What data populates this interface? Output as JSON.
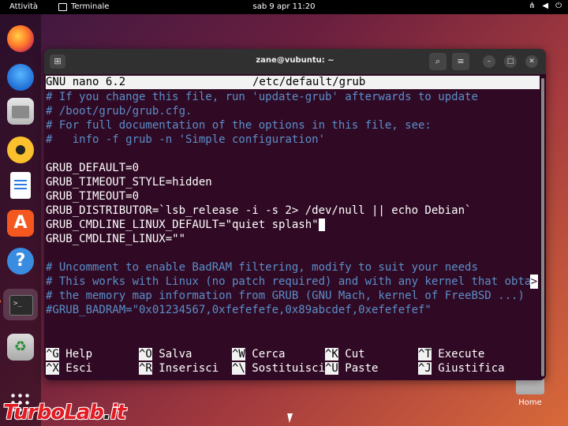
{
  "topbar": {
    "activities": "Attività",
    "app_name": "Terminale",
    "clock": "sab 9 apr  11:20"
  },
  "dock": {
    "apps": [
      "firefox-icon",
      "thunderbird-icon",
      "files-icon",
      "rhythmbox-icon",
      "writer-icon",
      "app-center-icon",
      "help-icon",
      "terminal-icon",
      "trash-icon",
      "show-apps-icon"
    ]
  },
  "desktop": {
    "home_label": "Home"
  },
  "watermark": {
    "text_a": "TurboLab",
    "dot": ".",
    "text_b": "it"
  },
  "window": {
    "title": "zane@vubuntu: ~"
  },
  "nano": {
    "version": "GNU nano 6.2",
    "file": "/etc/default/grub",
    "lines": [
      {
        "text": "# If you change this file, run 'update-grub' afterwards to update",
        "comment": true
      },
      {
        "text": "# /boot/grub/grub.cfg.",
        "comment": true
      },
      {
        "text": "# For full documentation of the options in this file, see:",
        "comment": true
      },
      {
        "text": "#   info -f grub -n 'Simple configuration'",
        "comment": true
      },
      {
        "text": "",
        "comment": false
      },
      {
        "text": "GRUB_DEFAULT=0",
        "comment": false
      },
      {
        "text": "GRUB_TIMEOUT_STYLE=hidden",
        "comment": false
      },
      {
        "text": "GRUB_TIMEOUT=0",
        "comment": false
      },
      {
        "text": "GRUB_DISTRIBUTOR=`lsb_release -i -s 2> /dev/null || echo Debian`",
        "comment": false
      },
      {
        "text": "GRUB_CMDLINE_LINUX_DEFAULT=\"quiet splash\"",
        "comment": false
      },
      {
        "text": "GRUB_CMDLINE_LINUX=\"\"",
        "comment": false
      },
      {
        "text": "",
        "comment": false
      },
      {
        "text": "# Uncomment to enable BadRAM filtering, modify to suit your needs",
        "comment": true
      },
      {
        "text": "# This works with Linux (no patch required) and with any kernel that obta",
        "comment": true
      },
      {
        "text": "# the memory map information from GRUB (GNU Mach, kernel of FreeBSD ...)",
        "comment": true
      },
      {
        "text": "#GRUB_BADRAM=\"0x01234567,0xfefefefe,0x89abcdef,0xefefefef\"",
        "comment": true
      }
    ],
    "more_marker": ">",
    "shortcuts": [
      {
        "key": "^G",
        "label": "Help"
      },
      {
        "key": "^O",
        "label": "Salva"
      },
      {
        "key": "^W",
        "label": "Cerca"
      },
      {
        "key": "^K",
        "label": "Cut"
      },
      {
        "key": "^T",
        "label": "Execute"
      },
      {
        "key": "^X",
        "label": "Esci"
      },
      {
        "key": "^R",
        "label": "Inserisci"
      },
      {
        "key": "^\\",
        "label": "Sostituisci"
      },
      {
        "key": "^U",
        "label": "Paste"
      },
      {
        "key": "^J",
        "label": "Giustifica"
      }
    ]
  }
}
